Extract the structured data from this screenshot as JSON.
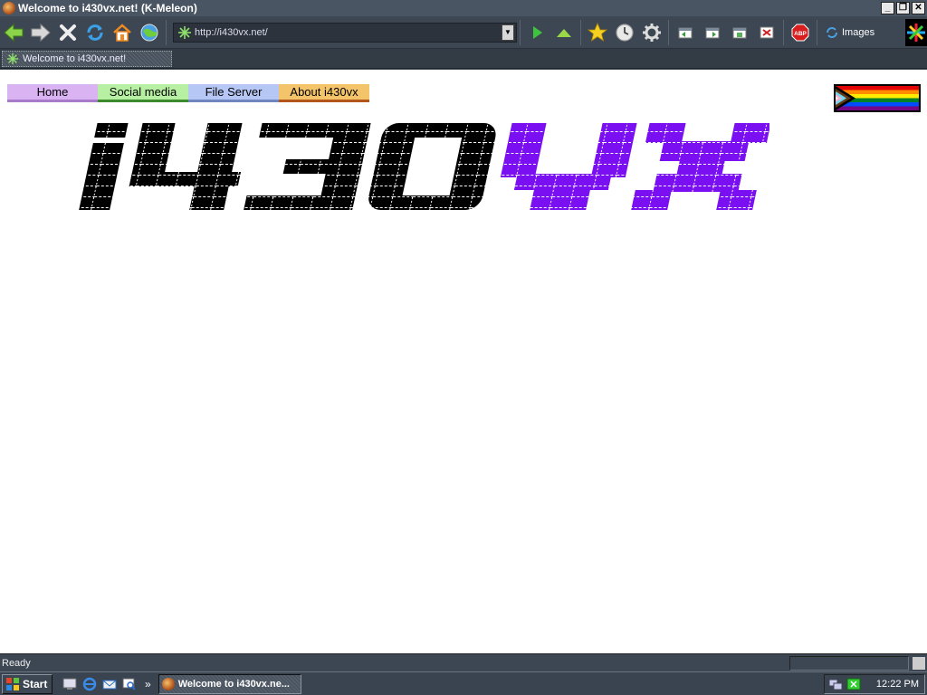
{
  "window": {
    "title": "Welcome to i430vx.net! (K-Meleon)",
    "controls": [
      "_",
      "❐",
      "✕"
    ]
  },
  "toolbar": {
    "url": "http://i430vx.net/",
    "images_label": "Images"
  },
  "tabs": [
    {
      "label": "Welcome to i430vx.net!"
    }
  ],
  "page": {
    "nav": [
      {
        "label": "Home",
        "color": "#d9b3f2"
      },
      {
        "label": "Social media",
        "color": "#b7f0a2"
      },
      {
        "label": "File Server",
        "color": "#b7c7f5"
      },
      {
        "label": "About i430vx",
        "color": "#f4c46a"
      }
    ],
    "logo": {
      "text_black": "i430",
      "text_purple": "vx",
      "black": "#000000",
      "purple": "#7a10f2"
    }
  },
  "status": {
    "text": "Ready"
  },
  "taskbar": {
    "start_label": "Start",
    "task_label": "Welcome to i430vx.ne...",
    "clock": "12:22 PM"
  }
}
